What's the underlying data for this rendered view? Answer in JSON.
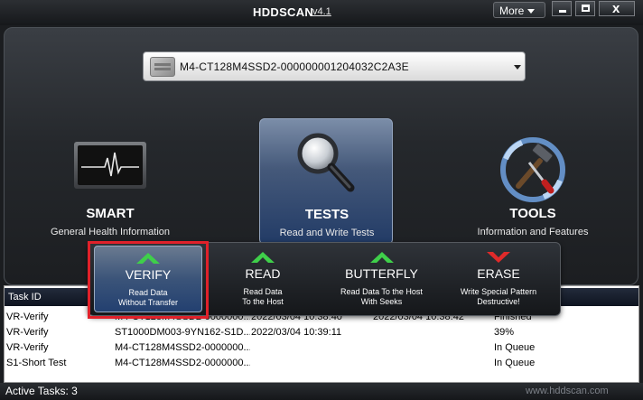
{
  "window": {
    "title": "HDDSCAN",
    "version": "v4.1",
    "more_label": "More",
    "close_glyph": "x"
  },
  "drive": {
    "selected": "M4-CT128M4SSD2-000000001204032C2A3E",
    "icon": "hard-drive-icon"
  },
  "categories": {
    "smart": {
      "title": "SMART",
      "subtitle": "General Health Information",
      "icon": "monitor-heartbeat-icon"
    },
    "tests": {
      "title": "TESTS",
      "subtitle": "Read and Write Tests",
      "icon": "magnifier-icon"
    },
    "tools": {
      "title": "TOOLS",
      "subtitle": "Information and Features",
      "icon": "hammer-screwdriver-icon"
    }
  },
  "tests_menu": {
    "verify": {
      "label": "VERIFY",
      "desc1": "Read Data",
      "desc2": "Without Transfer",
      "arrow_color": "#3fcf4a"
    },
    "read": {
      "label": "READ",
      "desc1": "Read Data",
      "desc2": "To the Host",
      "arrow_color": "#3fcf4a"
    },
    "butterfly": {
      "label": "BUTTERFLY",
      "desc1": "Read Data To the Host",
      "desc2": "With Seeks",
      "arrow_color": "#3fcf4a"
    },
    "erase": {
      "label": "ERASE",
      "desc1": "Write Special Pattern",
      "desc2": "Destructive!",
      "arrow_color": "#e02a2a"
    }
  },
  "tasks": {
    "header": {
      "task_id": "Task ID"
    },
    "rows": [
      {
        "id": "VR-Verify",
        "device": "M4-CT128M4SSD2-0000000...",
        "start": "2022/03/04 10:38:40",
        "end": "2022/03/04 10:38:42",
        "status": "Finished"
      },
      {
        "id": "VR-Verify",
        "device": "ST1000DM003-9YN162-S1D...",
        "start": "2022/03/04 10:39:11",
        "end": "",
        "status": "39%"
      },
      {
        "id": "VR-Verify",
        "device": "M4-CT128M4SSD2-0000000...",
        "start": "",
        "end": "",
        "status": "In Queue"
      },
      {
        "id": "S1-Short Test",
        "device": "M4-CT128M4SSD2-0000000...",
        "start": "",
        "end": "",
        "status": "In Queue"
      }
    ]
  },
  "status": {
    "active_tasks": "Active Tasks: 3",
    "website": "www.hddscan.com"
  },
  "colors": {
    "highlight": "#e0212a",
    "tests_active": "#2a4a7c"
  }
}
